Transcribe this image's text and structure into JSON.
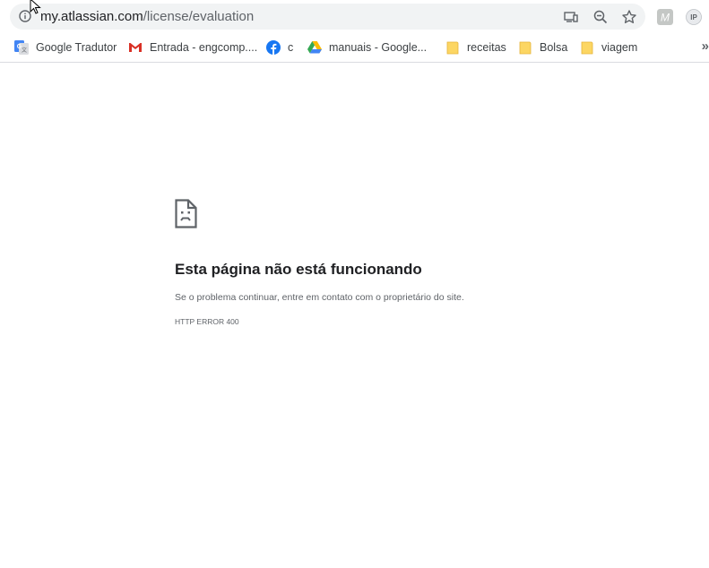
{
  "address_bar": {
    "url_host": "my.atlassian.com",
    "url_path": "/license/evaluation",
    "icons": [
      "info-icon",
      "cast-icon",
      "zoom-out-icon",
      "bookmark-star-icon"
    ]
  },
  "extensions": [
    {
      "name": "m-extension-icon",
      "label": "M"
    },
    {
      "name": "ip-extension-icon",
      "label": "IP"
    }
  ],
  "bookmarks": {
    "items": [
      {
        "label": "Google Tradutor",
        "icon": "google-translate-icon"
      },
      {
        "label": "Entrada - engcomp....",
        "icon": "gmail-icon"
      },
      {
        "label": "c",
        "icon": "facebook-icon"
      },
      {
        "label": "manuais - Google...",
        "icon": "google-drive-icon"
      },
      {
        "label": "receitas",
        "icon": "folder-icon"
      },
      {
        "label": "Bolsa",
        "icon": "folder-icon"
      },
      {
        "label": "viagem",
        "icon": "folder-icon"
      }
    ],
    "more": "»"
  },
  "error_page": {
    "icon": "broken-page-icon",
    "title": "Esta página não está funcionando",
    "description": "Se o problema continuar, entre em contato com o proprietário do site.",
    "code": "HTTP ERROR 400"
  },
  "colors": {
    "omnibox_bg": "#f1f3f4",
    "text_primary": "#202124",
    "text_secondary": "#5f6368",
    "folder": "#fcd663",
    "facebook": "#1877f2",
    "gmail": "#d93025"
  }
}
